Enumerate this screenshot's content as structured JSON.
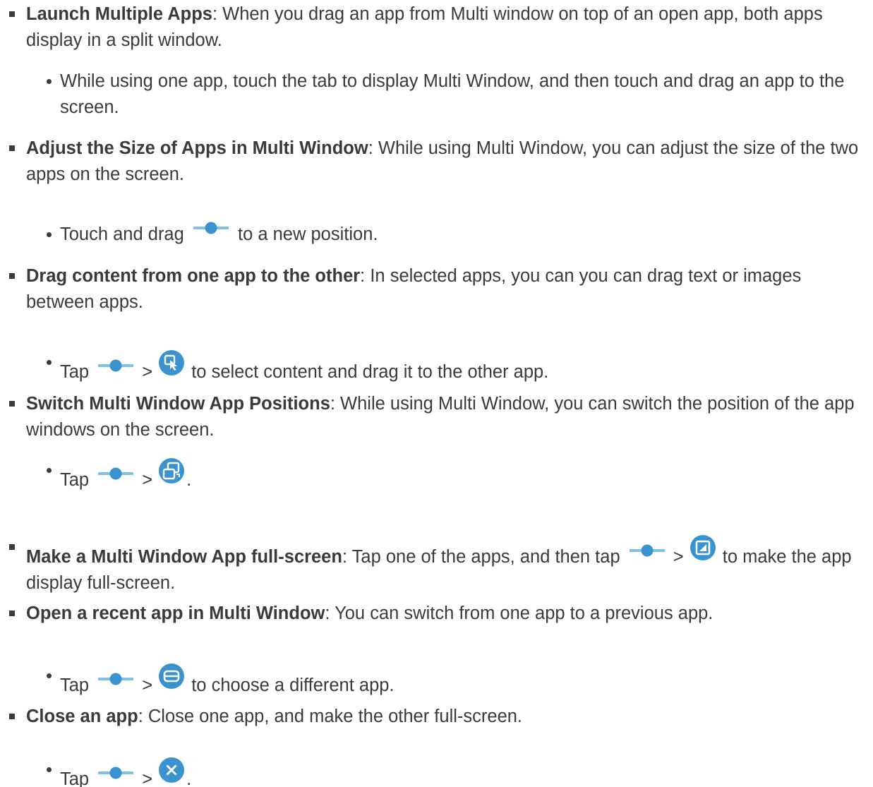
{
  "colors": {
    "text": "#3a3a3a",
    "icon_blue": "#3a93cf",
    "icon_light": "#7ec2e8"
  },
  "items": [
    {
      "title": "Launch Multiple Apps",
      "text": ": When you drag an app from Multi window on top of an open app, both apps display in a split window.",
      "sub": "While using one app, touch the tab to display Multi Window, and then touch and drag an app to the screen."
    },
    {
      "title": "Adjust the Size of Apps in Multi Window",
      "text": ": While using Multi Window, you can adjust the size of the two apps on the screen.",
      "sub_before": "Touch and drag",
      "sub_after": "to a new position.",
      "icons": [
        "multi-window-handle-icon"
      ]
    },
    {
      "title": "Drag content from one app to the other",
      "text": ": In selected apps, you can you can drag text or images between apps.",
      "sub_before": "Tap",
      "sub_sep": ">",
      "sub_after": "to select content and drag it to the other app.",
      "icons": [
        "multi-window-handle-icon",
        "drag-content-icon"
      ]
    },
    {
      "title": "Switch Multi Window App Positions",
      "text": ": While using Multi Window, you can switch the position of the app windows on the screen.",
      "sub_before": "Tap",
      "sub_sep": ">",
      "sub_after": ".",
      "icons": [
        "multi-window-handle-icon",
        "switch-windows-icon"
      ]
    },
    {
      "title": "Make a Multi Window App full-screen",
      "text_before": ": Tap one of the apps, and then tap",
      "sep": ">",
      "text_after": "to make the app display full-screen.",
      "icons": [
        "multi-window-handle-icon",
        "full-screen-icon"
      ]
    },
    {
      "title": "Open a recent app in Multi Window",
      "text": ": You can switch from one app to a previous app.",
      "sub_before": "Tap",
      "sub_sep": ">",
      "sub_after": "to choose a different app.",
      "icons": [
        "multi-window-handle-icon",
        "recent-app-icon"
      ]
    },
    {
      "title": "Close an app",
      "text": ": Close one app, and make the other full-screen.",
      "sub_before": "Tap",
      "sub_sep": ">",
      "sub_after": ".",
      "icons": [
        "multi-window-handle-icon",
        "close-app-icon"
      ]
    }
  ]
}
